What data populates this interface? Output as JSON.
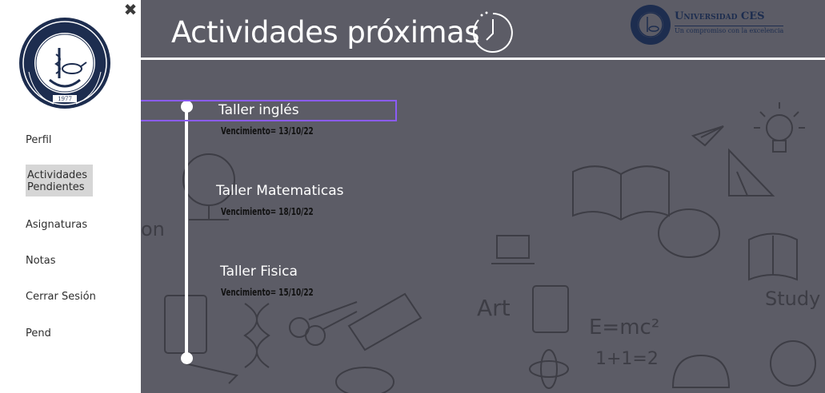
{
  "sidebar": {
    "close_glyph": "✖",
    "items": [
      {
        "label": "Perfil"
      },
      {
        "label": "Actividades Pendientes",
        "active": true
      },
      {
        "label": "Asignaturas"
      },
      {
        "label": "Notas"
      },
      {
        "label": "Cerrar Sesión"
      },
      {
        "label": "Pend"
      }
    ]
  },
  "header": {
    "title": "Actividades próximas",
    "brand_name": "Universidad CES",
    "brand_tagline": "Un compromiso con la excelencia"
  },
  "activities": [
    {
      "title": "Taller inglés",
      "due": "Vencimiento= 13/10/22"
    },
    {
      "title": "Taller Matematicas",
      "due": "Vencimiento= 18/10/22"
    },
    {
      "title": "Taller Fisica",
      "due": "Vencimiento= 15/10/22"
    }
  ],
  "colors": {
    "sidebar_bg": "#ffffff",
    "main_bg": "#5c5c66",
    "active_item_bg": "#d6d6d6",
    "brand_navy": "#1d2d4f",
    "highlight": "#8b5cf6"
  }
}
